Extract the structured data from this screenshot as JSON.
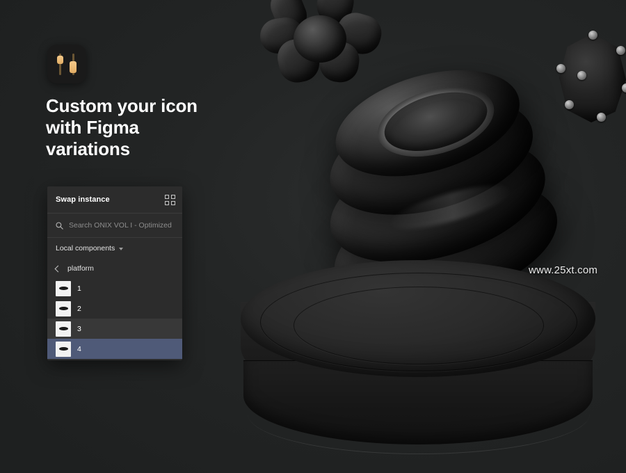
{
  "background_color": "#222424",
  "hero": {
    "app_icon": {
      "name": "figma-variations-app-icon",
      "background": "#1a1a1a",
      "accent": "#e2ad64"
    },
    "headline": "Custom your icon with Figma variations"
  },
  "panel": {
    "title": "Swap instance",
    "grid_icon": "grid-view-icon",
    "search": {
      "icon": "search-icon",
      "placeholder": "Search ONIX VOL I - Optimized",
      "value": ""
    },
    "section": {
      "label": "Local components",
      "chevron": "chevron-down-icon"
    },
    "breadcrumb": {
      "back_icon": "chevron-left-icon",
      "label": "platform"
    },
    "items": [
      {
        "label": "1",
        "state": "normal"
      },
      {
        "label": "2",
        "state": "normal"
      },
      {
        "label": "3",
        "state": "hovered"
      },
      {
        "label": "4",
        "state": "selected"
      }
    ],
    "colors": {
      "background": "#2c2c2c",
      "hover": "#383838",
      "selected": "#4f5a78",
      "divider": "#3b3b3b"
    }
  },
  "scene": {
    "objects": [
      {
        "name": "jack-cross-3d-object",
        "position": "top-center"
      },
      {
        "name": "faceted-polyhedron-3d-object",
        "position": "top-right"
      },
      {
        "name": "stacked-ring-knob-3d-object",
        "position": "center"
      },
      {
        "name": "cylindrical-podium-3d-object",
        "position": "bottom-center"
      }
    ]
  },
  "watermark": "www.25xt.com"
}
